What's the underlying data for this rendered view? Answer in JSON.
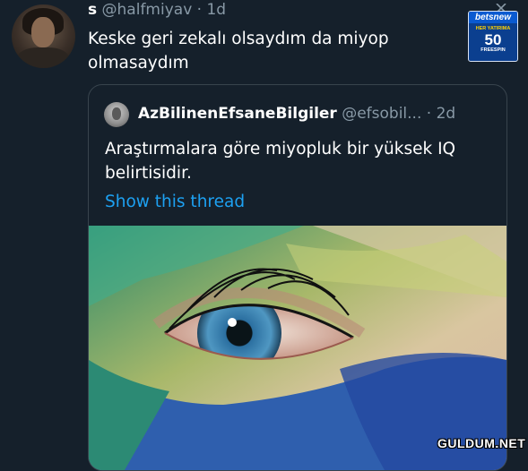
{
  "tweet": {
    "name": "s",
    "handle": "@halfmiyav",
    "separator": "·",
    "time": "1d",
    "text": "Keske geri zekalı olsaydım da miyop olmasaydım"
  },
  "quoted_tweet": {
    "name": "AzBilinenEfsaneBilgiler",
    "handle": "@efsobil...",
    "separator": "·",
    "time": "2d",
    "text": "Araştırmalara göre miyopluk bir yüksek IQ belirtisidir.",
    "link": "Show this thread"
  },
  "ad": {
    "brand": "betsnew",
    "line1": "HER YATIRIMA",
    "amount": "50",
    "line2": "FREESPIN"
  },
  "watermark": "GULDUM.NET",
  "colors": {
    "background": "#15202b",
    "secondary_text": "#8899a6",
    "link": "#1da1f2",
    "border": "#38444d"
  },
  "icons": {
    "close": "close-icon"
  }
}
